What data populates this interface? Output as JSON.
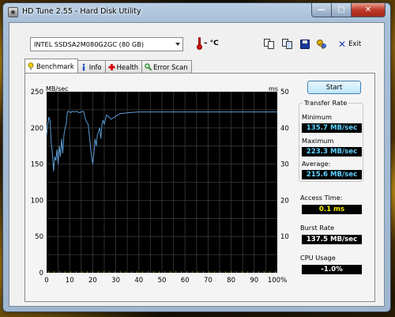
{
  "window": {
    "title": "HD Tune 2.55 - Hard Disk Utility",
    "caption": {
      "minimize": "—",
      "maximize": "□",
      "close": "✕"
    }
  },
  "toolbar": {
    "drive": "INTEL SSDSA2M080G2GC (80 GB)",
    "temperature": "– °C",
    "exit_label": "Exit",
    "icons": [
      "thermometer-icon",
      "copy-text-icon",
      "copy-image-icon",
      "save-icon",
      "options-icon",
      "exit-icon"
    ]
  },
  "tabs": [
    {
      "label": "Benchmark",
      "icon": "benchmark-icon",
      "active": true
    },
    {
      "label": "Info",
      "icon": "info-icon",
      "active": false
    },
    {
      "label": "Health",
      "icon": "health-icon",
      "active": false
    },
    {
      "label": "Error Scan",
      "icon": "error-scan-icon",
      "active": false
    }
  ],
  "benchmark": {
    "start_label": "Start",
    "transfer_rate_title": "Transfer Rate",
    "minimum_label": "Minimum",
    "minimum_value": "135.7 MB/sec",
    "maximum_label": "Maximum",
    "maximum_value": "223.3 MB/sec",
    "average_label": "Average:",
    "average_value": "215.6 MB/sec",
    "access_time_label": "Access Time:",
    "access_time_value": "0.1 ms",
    "burst_rate_label": "Burst Rate",
    "burst_rate_value": "137.5 MB/sec",
    "cpu_usage_label": "CPU Usage",
    "cpu_usage_value": "-1.0%"
  },
  "chart_data": {
    "type": "line",
    "ylabel": "MB/sec",
    "y2label": "ms",
    "ylim": [
      0,
      250
    ],
    "y2lim": [
      0,
      50
    ],
    "yticks": [
      "250",
      "200",
      "150",
      "100",
      "50",
      "0"
    ],
    "y2ticks": [
      "50",
      "40",
      "30",
      "20",
      "10"
    ],
    "xticks": [
      "0",
      "10",
      "20",
      "30",
      "40",
      "50",
      "60",
      "70",
      "80",
      "90",
      "100%"
    ],
    "xlim": [
      0,
      100
    ],
    "grid": true,
    "background": "#000000",
    "grid_color": "#3a3a3a",
    "line_color": "#5b9bd5",
    "access_color": "#e8d800",
    "series": [
      {
        "name": "",
        "x": [
          0,
          0.5,
          1,
          1.5,
          2,
          2.5,
          3,
          3.5,
          4,
          4.5,
          5,
          5.5,
          6,
          6.5,
          7,
          7.5,
          8,
          8.5,
          9,
          9.5,
          10,
          10.5,
          11,
          12,
          13,
          14,
          15,
          16,
          17,
          18,
          18.5,
          19,
          19.5,
          20,
          20.5,
          21,
          21.5,
          22,
          22.5,
          23,
          23.5,
          24,
          24.5,
          25,
          25.5,
          26,
          27,
          28,
          29,
          30,
          31,
          32,
          33,
          35,
          40,
          50,
          60,
          70,
          80,
          90,
          100
        ],
        "y": [
          190,
          205,
          215,
          210,
          180,
          165,
          140,
          160,
          155,
          170,
          150,
          175,
          160,
          185,
          165,
          190,
          200,
          205,
          222,
          223,
          222,
          221,
          223,
          222,
          223,
          221,
          222,
          223,
          210,
          205,
          190,
          175,
          160,
          150,
          165,
          185,
          175,
          190,
          195,
          200,
          185,
          205,
          210,
          205,
          212,
          218,
          215,
          212,
          214,
          216,
          218,
          220,
          220,
          221,
          222,
          222,
          222,
          222,
          222,
          222,
          222
        ]
      }
    ]
  }
}
